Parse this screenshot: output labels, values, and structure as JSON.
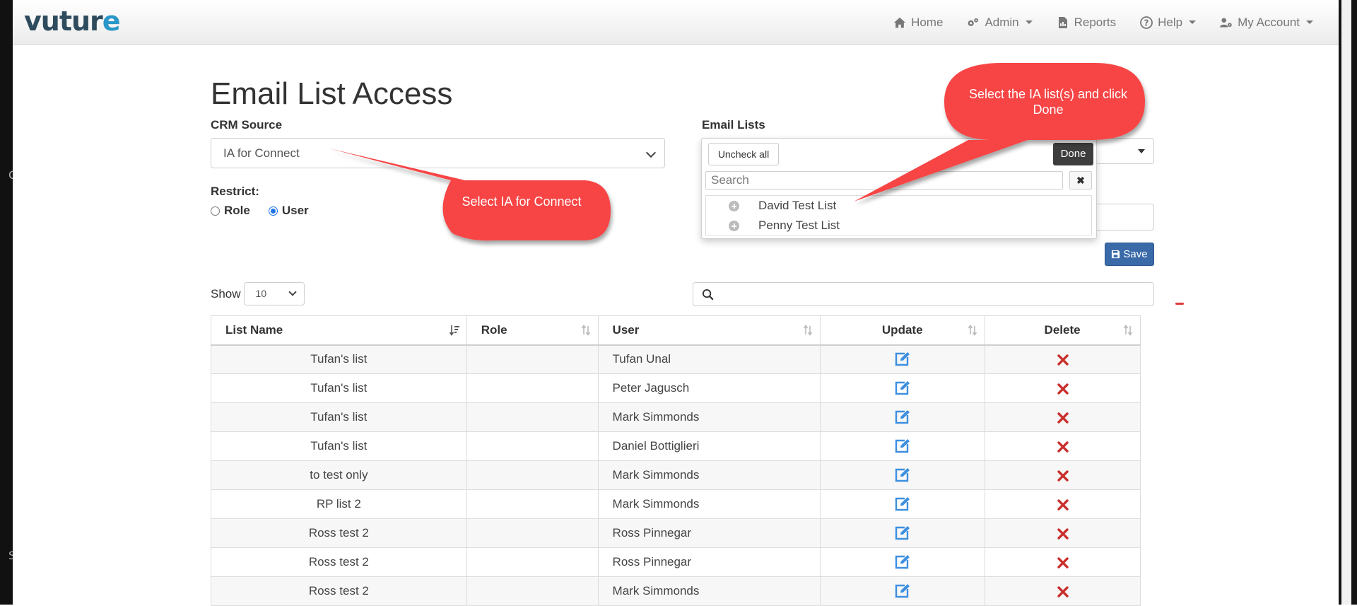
{
  "nav": {
    "logo": "vuture",
    "items": [
      {
        "label": "Home",
        "icon": "home-icon",
        "dropdown": false
      },
      {
        "label": "Admin",
        "icon": "cogs-icon",
        "dropdown": true
      },
      {
        "label": "Reports",
        "icon": "file-chart-icon",
        "dropdown": false
      },
      {
        "label": "Help",
        "icon": "question-circle-icon",
        "dropdown": true
      },
      {
        "label": "My Account",
        "icon": "user-cog-icon",
        "dropdown": true
      }
    ]
  },
  "page": {
    "title": "Email List Access",
    "crm_source_label": "CRM Source",
    "crm_source_value": "IA for Connect",
    "restrict_label": "Restrict:",
    "radio_role": "Role",
    "radio_user": "User",
    "radio_selected": "User",
    "email_lists_label": "Email Lists",
    "save_label": "Save"
  },
  "email_dropdown": {
    "uncheck_all": "Uncheck all",
    "done": "Done",
    "search_placeholder": "Search",
    "clear": "✖",
    "items": [
      "David Test List",
      "Penny Test List"
    ]
  },
  "table_controls": {
    "show_label": "Show",
    "show_value": "10"
  },
  "table": {
    "columns": [
      "List Name",
      "Role",
      "User",
      "Update",
      "Delete"
    ],
    "rows": [
      {
        "list": "Tufan's list",
        "role": "",
        "user": "Tufan Unal"
      },
      {
        "list": "Tufan's list",
        "role": "",
        "user": "Peter Jagusch"
      },
      {
        "list": "Tufan's list",
        "role": "",
        "user": "Mark Simmonds"
      },
      {
        "list": "Tufan's list",
        "role": "",
        "user": "Daniel Bottiglieri"
      },
      {
        "list": "to test only",
        "role": "",
        "user": "Mark Simmonds"
      },
      {
        "list": "RP list 2",
        "role": "",
        "user": "Mark Simmonds"
      },
      {
        "list": "Ross test 2",
        "role": "",
        "user": "Ross Pinnegar"
      },
      {
        "list": "Ross test 2",
        "role": "",
        "user": "Ross Pinnegar"
      },
      {
        "list": "Ross test 2",
        "role": "",
        "user": "Mark Simmonds"
      }
    ]
  },
  "callouts": [
    {
      "text": "Select IA for Connect"
    },
    {
      "text": "Select the IA list(s) and click Done"
    }
  ],
  "colors": {
    "callout": "#f74545",
    "save_button": "#3a6aa8",
    "edit_icon": "#3d8fe0",
    "delete_icon": "#c9302c"
  }
}
